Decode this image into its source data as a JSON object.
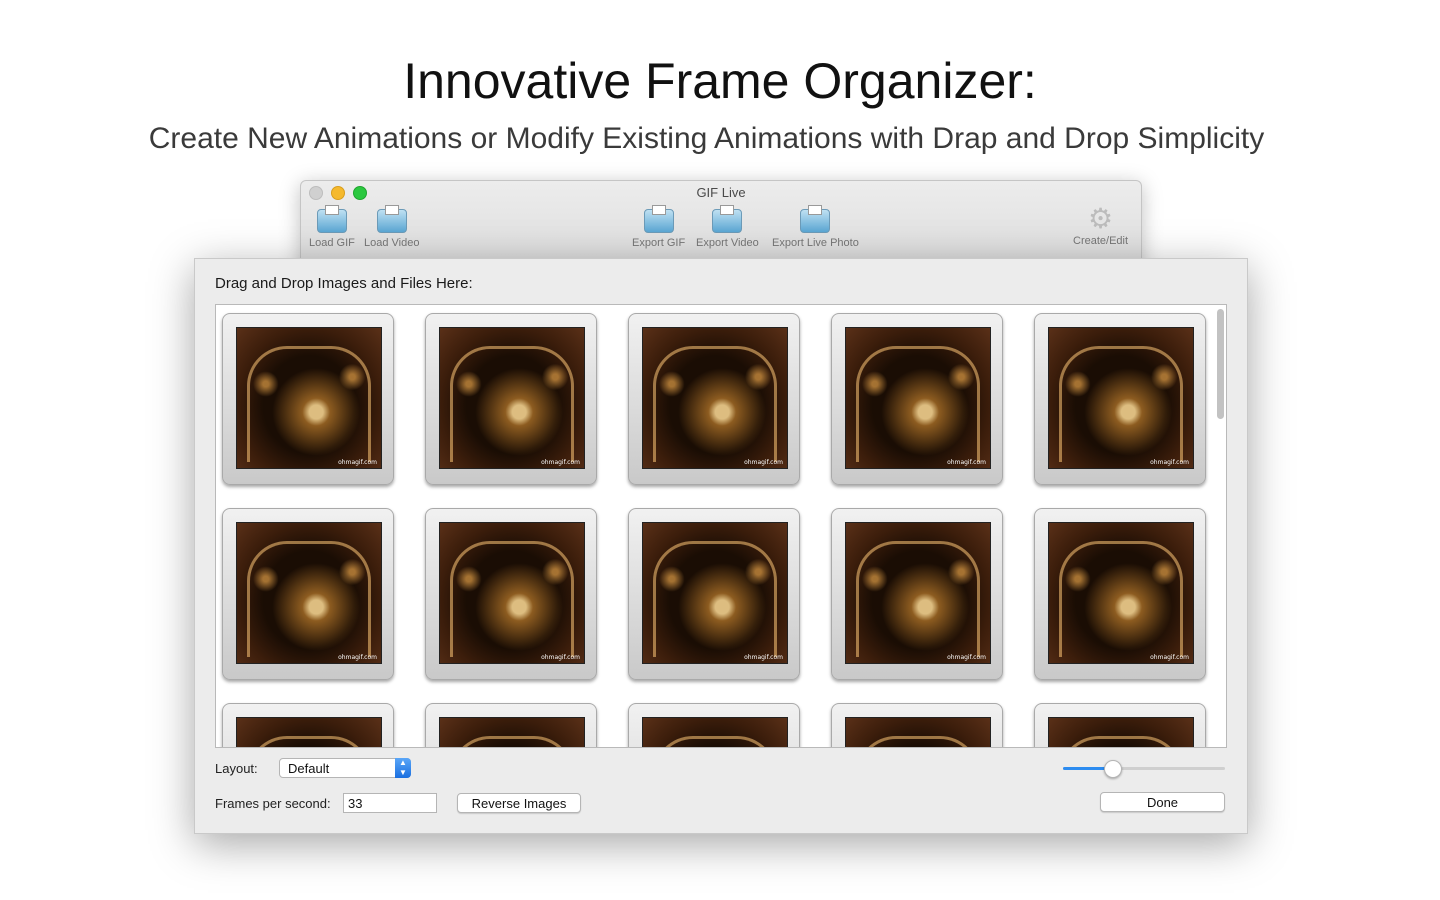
{
  "headline": "Innovative Frame Organizer:",
  "subhead": "Create New Animations or Modify Existing Animations with Drap and Drop Simplicity",
  "window": {
    "title": "GIF Live",
    "toolbar": {
      "load_gif": "Load GIF",
      "load_video": "Load Video",
      "export_gif": "Export GIF",
      "export_video": "Export Video",
      "export_live_photo": "Export Live Photo",
      "create_edit": "Create/Edit"
    }
  },
  "sheet": {
    "drop_label": "Drag and Drop Images and Files Here:",
    "frames": [
      {
        "watermark": "ohmagif.com"
      },
      {
        "watermark": "ohmagif.com"
      },
      {
        "watermark": "ohmagif.com"
      },
      {
        "watermark": "ohmagif.com"
      },
      {
        "watermark": "ohmagif.com"
      },
      {
        "watermark": "ohmagif.com"
      },
      {
        "watermark": "ohmagif.com"
      },
      {
        "watermark": "ohmagif.com"
      },
      {
        "watermark": "ohmagif.com"
      },
      {
        "watermark": "ohmagif.com"
      },
      {
        "watermark": ""
      },
      {
        "watermark": ""
      },
      {
        "watermark": ""
      },
      {
        "watermark": ""
      },
      {
        "watermark": ""
      }
    ],
    "layout_label": "Layout:",
    "layout_value": "Default",
    "fps_label": "Frames per second:",
    "fps_value": "33",
    "reverse_button": "Reverse Images",
    "done_button": "Done",
    "zoom_slider_value": 0.3
  },
  "colors": {
    "accent": "#2d8cf0",
    "traffic_close": "#d0d0d0",
    "traffic_minimize": "#f5b92d",
    "traffic_maximize": "#2bc840"
  }
}
